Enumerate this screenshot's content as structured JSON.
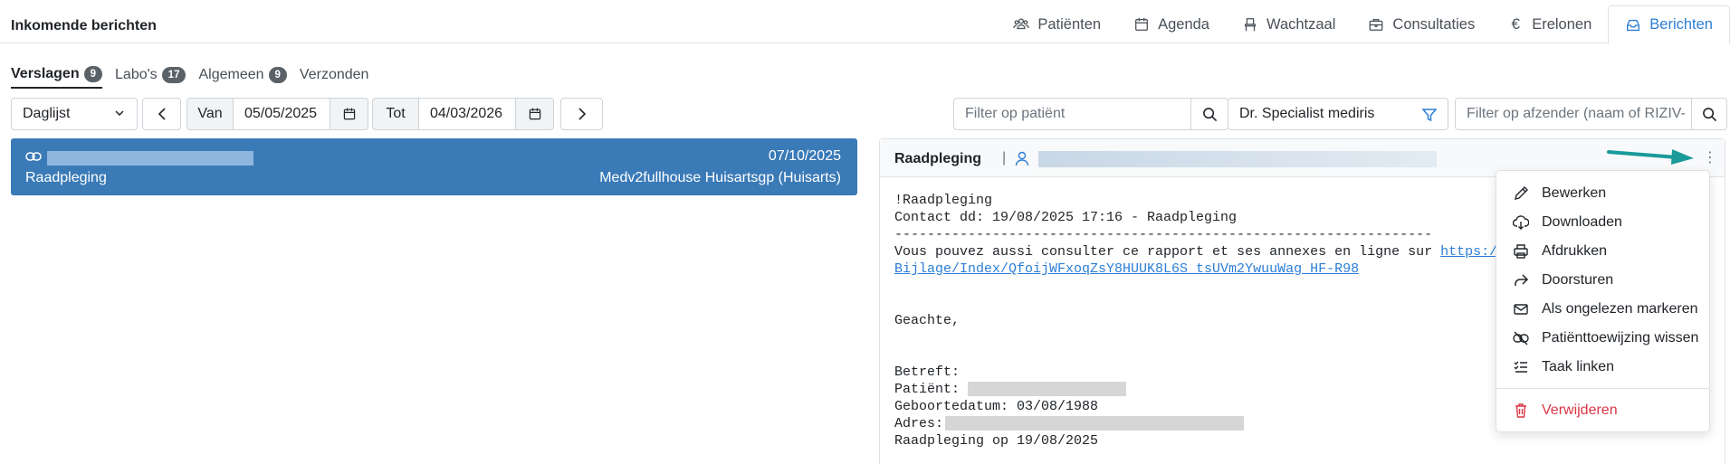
{
  "header": {
    "title": "Inkomende berichten",
    "nav": [
      {
        "label": "Patiënten",
        "icon": "users-icon"
      },
      {
        "label": "Agenda",
        "icon": "calendar-icon"
      },
      {
        "label": "Wachtzaal",
        "icon": "chair-icon"
      },
      {
        "label": "Consultaties",
        "icon": "briefcase-icon"
      },
      {
        "label": "Erelonen",
        "icon": "euro-icon"
      },
      {
        "label": "Berichten",
        "icon": "inbox-icon",
        "active": true
      }
    ]
  },
  "subtabs": [
    {
      "label": "Verslagen",
      "count": "9",
      "active": true
    },
    {
      "label": "Labo's",
      "count": "17"
    },
    {
      "label": "Algemeen",
      "count": "9"
    },
    {
      "label": "Verzonden"
    }
  ],
  "toolbar": {
    "list_select": "Daglijst",
    "from_label": "Van",
    "from_date": "05/05/2025",
    "to_label": "Tot",
    "to_date": "04/03/2026",
    "patient_filter_placeholder": "Filter op patiënt",
    "doctor_select": "Dr. Specialist mediris",
    "sender_filter_placeholder": "Filter op afzender (naam of RIZIV-"
  },
  "message_list": [
    {
      "date": "07/10/2025",
      "type": "Raadpleging",
      "sender": "Medv2fullhouse Huisartsgp (Huisarts)"
    }
  ],
  "detail": {
    "title": "Raadpleging",
    "separator": "|",
    "lines": {
      "l1": "!Raadpleging",
      "l2": "Contact dd: 19/08/2025 17:16 - Raadpleging",
      "l3": "------------------------------------------------------------------",
      "l4_text": "Vous pouvez aussi consulter ce rapport et ses annexes en ligne sur ",
      "l4_link": "https://m",
      "l5_link": "Bijlage/Index/QfoijWFxoqZsY8HUUK8L6S_tsUVm2YwuuWag_HF-R98",
      "l6": "Geachte,",
      "l7": "Betreft:",
      "l8": "Patiënt: ",
      "l9": "Geboortedatum: 03/08/1988",
      "l10": "Adres: ",
      "l11": "Raadpleging op 19/08/2025"
    }
  },
  "menu": {
    "items": [
      {
        "label": "Bewerken",
        "icon": "pencil-icon"
      },
      {
        "label": "Downloaden",
        "icon": "cloud-download-icon"
      },
      {
        "label": "Afdrukken",
        "icon": "printer-icon"
      },
      {
        "label": "Doorsturen",
        "icon": "forward-icon"
      },
      {
        "label": "Als ongelezen markeren",
        "icon": "envelope-icon"
      },
      {
        "label": "Patiënttoewijzing wissen",
        "icon": "unlink-icon"
      },
      {
        "label": "Taak linken",
        "icon": "tasklist-icon"
      }
    ],
    "danger_item": {
      "label": "Verwijderen",
      "icon": "trash-icon"
    }
  },
  "colors": {
    "accent": "#2c7ed6",
    "selected_row": "#3a7ab7",
    "danger": "#dc3545",
    "arrow": "#1a9a9a"
  }
}
